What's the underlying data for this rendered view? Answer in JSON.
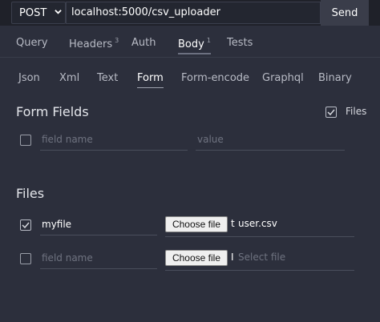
{
  "request": {
    "method": "POST",
    "url": "localhost:5000/csv_uploader",
    "send_label": "Send"
  },
  "tabs": {
    "query": "Query",
    "headers": "Headers",
    "headers_count": "3",
    "auth": "Auth",
    "body": "Body",
    "body_count": "1",
    "tests": "Tests"
  },
  "body_types": {
    "json": "Json",
    "xml": "Xml",
    "text": "Text",
    "form": "Form",
    "form_encode": "Form-encode",
    "graphql": "Graphql",
    "binary": "Binary"
  },
  "form_fields": {
    "title": "Form Fields",
    "files_toggle_label": "Files",
    "files_toggle_checked": true,
    "row": {
      "checked": false,
      "name_placeholder": "field name",
      "value_placeholder": "value"
    }
  },
  "files": {
    "title": "Files",
    "rows": [
      {
        "checked": true,
        "name": "myfile",
        "button": "Choose file",
        "frag": "t",
        "file_name": "user.csv"
      },
      {
        "checked": false,
        "name_placeholder": "field name",
        "button": "Choose file",
        "frag": "I",
        "file_placeholder": "Select file"
      }
    ]
  },
  "colors": {
    "background": "#2c2f3c",
    "topbar": "#1f2129",
    "send_button": "#3a3d4a"
  }
}
